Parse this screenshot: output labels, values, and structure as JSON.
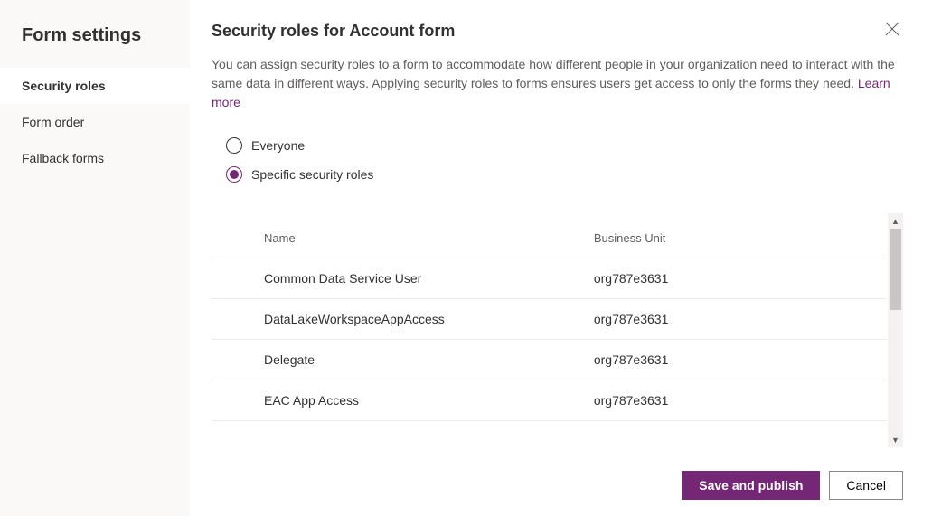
{
  "sidebar": {
    "title": "Form settings",
    "items": [
      {
        "label": "Security roles",
        "active": true
      },
      {
        "label": "Form order",
        "active": false
      },
      {
        "label": "Fallback forms",
        "active": false
      }
    ]
  },
  "main": {
    "title": "Security roles for Account form",
    "description": "You can assign security roles to a form to accommodate how different people in your organization need to interact with the same data in different ways. Applying security roles to forms ensures users get access to only the forms they need. ",
    "learn_more": "Learn more",
    "radio": {
      "everyone": "Everyone",
      "specific": "Specific security roles",
      "selected": "specific"
    },
    "table": {
      "col_name": "Name",
      "col_business_unit": "Business Unit",
      "rows": [
        {
          "name": "Common Data Service User",
          "bu": "org787e3631"
        },
        {
          "name": "DataLakeWorkspaceAppAccess",
          "bu": "org787e3631"
        },
        {
          "name": "Delegate",
          "bu": "org787e3631"
        },
        {
          "name": "EAC App Access",
          "bu": "org787e3631"
        }
      ]
    },
    "footer": {
      "save_publish": "Save and publish",
      "cancel": "Cancel"
    }
  }
}
